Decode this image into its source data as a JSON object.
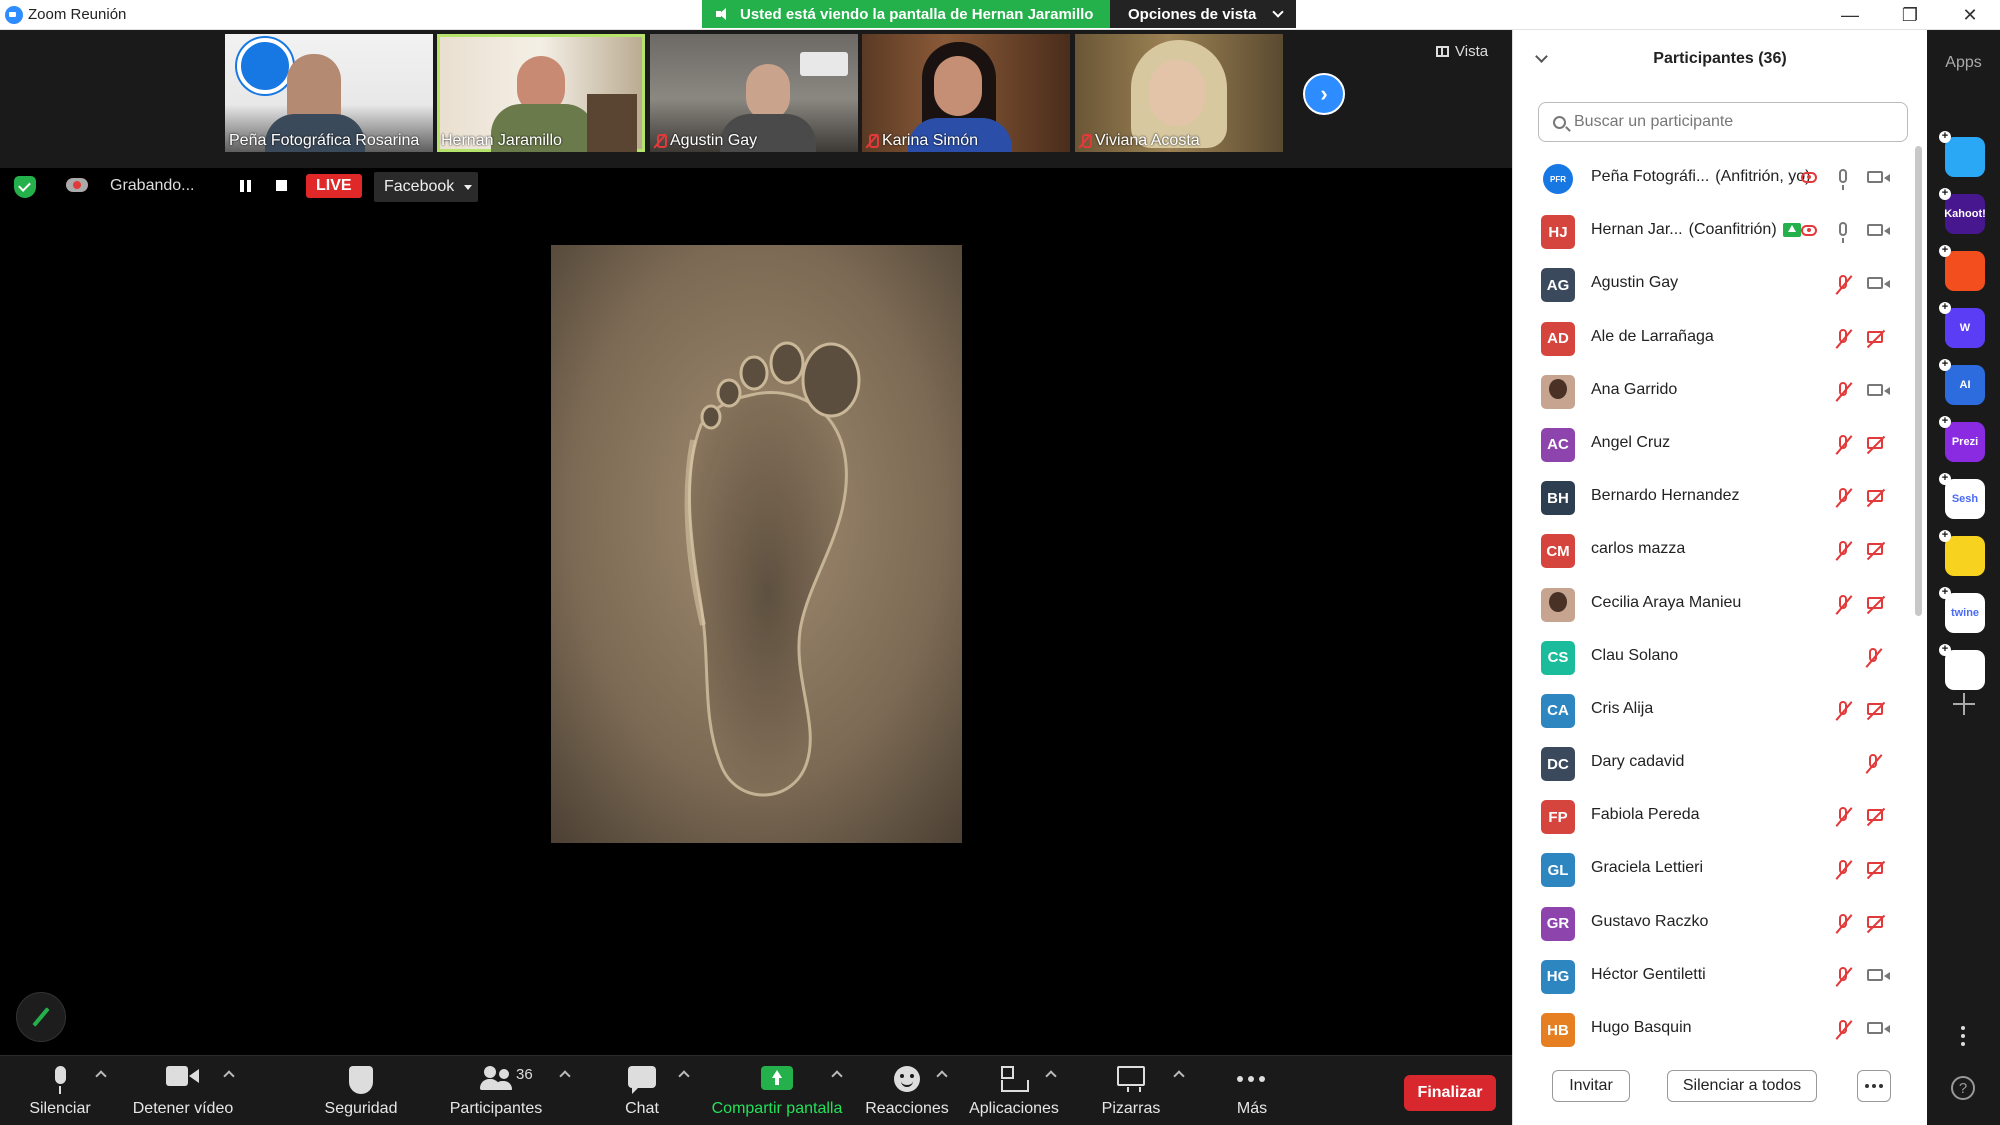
{
  "window": {
    "title": "Zoom Reunión",
    "controls": [
      "—",
      "❐",
      "✕"
    ]
  },
  "share_banner": {
    "message": "Usted está viendo la pantalla de Hernan Jaramillo",
    "view_options": "Opciones de vista"
  },
  "thumbnails": [
    {
      "name": "Peña Fotográfica Rosarina",
      "muted": false,
      "active": false
    },
    {
      "name": "Hernan Jaramillo",
      "muted": false,
      "active": true
    },
    {
      "name": "Agustin Gay",
      "muted": true,
      "active": false
    },
    {
      "name": "Karina Simón",
      "muted": true,
      "active": false
    },
    {
      "name": "Viviana Acosta",
      "muted": true,
      "active": false
    }
  ],
  "view_button": "Vista",
  "recording": {
    "status": "Grabando...",
    "live_badge": "LIVE",
    "platform": "Facebook"
  },
  "toolbar": {
    "mute": "Silenciar",
    "stop_video": "Detener vídeo",
    "security": "Seguridad",
    "participants": "Participantes",
    "participants_count": "36",
    "chat": "Chat",
    "share_screen": "Compartir pantalla",
    "reactions": "Reacciones",
    "apps": "Aplicaciones",
    "whiteboards": "Pizarras",
    "more": "Más",
    "end": "Finalizar"
  },
  "panel": {
    "title": "Participantes (36)",
    "search_placeholder": "Buscar un participante",
    "participants": [
      {
        "initials": "",
        "avatar": "logo",
        "name": "Peña Fotográfi...",
        "role": "(Anfitrión, yo)",
        "mic": "on",
        "cam": "on",
        "rec": true,
        "cohost": false,
        "color": "#ffffff"
      },
      {
        "initials": "HJ",
        "avatar": "initials",
        "name": "Hernan Jar...",
        "role": "(Coanfitrión)",
        "mic": "on",
        "cam": "on",
        "rec": true,
        "cohost": true,
        "color": "#d6453d"
      },
      {
        "initials": "AG",
        "avatar": "initials",
        "name": "Agustin Gay",
        "role": "",
        "mic": "off",
        "cam": "on",
        "rec": false,
        "cohost": false,
        "color": "#3a4a5c"
      },
      {
        "initials": "AD",
        "avatar": "initials",
        "name": "Ale de Larrañaga",
        "role": "",
        "mic": "off",
        "cam": "off",
        "rec": false,
        "cohost": false,
        "color": "#d6453d"
      },
      {
        "initials": "",
        "avatar": "photo",
        "name": "Ana Garrido",
        "role": "",
        "mic": "off",
        "cam": "on",
        "rec": false,
        "cohost": false,
        "color": "#c7a48f"
      },
      {
        "initials": "AC",
        "avatar": "initials",
        "name": "Angel Cruz",
        "role": "",
        "mic": "off",
        "cam": "off",
        "rec": false,
        "cohost": false,
        "color": "#8e44ad"
      },
      {
        "initials": "BH",
        "avatar": "initials",
        "name": "Bernardo Hernandez",
        "role": "",
        "mic": "off",
        "cam": "off",
        "rec": false,
        "cohost": false,
        "color": "#2c3e50"
      },
      {
        "initials": "CM",
        "avatar": "initials",
        "name": "carlos mazza",
        "role": "",
        "mic": "off",
        "cam": "off",
        "rec": false,
        "cohost": false,
        "color": "#d6453d"
      },
      {
        "initials": "",
        "avatar": "photo",
        "name": "Cecilia Araya Manieu",
        "role": "",
        "mic": "off",
        "cam": "off",
        "rec": false,
        "cohost": false,
        "color": "#c7a48f"
      },
      {
        "initials": "CS",
        "avatar": "initials",
        "name": "Clau Solano",
        "role": "",
        "mic": "off-far",
        "cam": "none",
        "rec": false,
        "cohost": false,
        "color": "#1abc9c"
      },
      {
        "initials": "CA",
        "avatar": "initials",
        "name": "Cris Alija",
        "role": "",
        "mic": "off",
        "cam": "off",
        "rec": false,
        "cohost": false,
        "color": "#2e86c1"
      },
      {
        "initials": "DC",
        "avatar": "initials",
        "name": "Dary cadavid",
        "role": "",
        "mic": "off-far",
        "cam": "none",
        "rec": false,
        "cohost": false,
        "color": "#3a4a5c"
      },
      {
        "initials": "FP",
        "avatar": "initials",
        "name": "Fabiola Pereda",
        "role": "",
        "mic": "off",
        "cam": "off",
        "rec": false,
        "cohost": false,
        "color": "#d6453d"
      },
      {
        "initials": "GL",
        "avatar": "initials",
        "name": "Graciela Lettieri",
        "role": "",
        "mic": "off",
        "cam": "off",
        "rec": false,
        "cohost": false,
        "color": "#2e86c1"
      },
      {
        "initials": "GR",
        "avatar": "initials",
        "name": "Gustavo Raczko",
        "role": "",
        "mic": "off",
        "cam": "off",
        "rec": false,
        "cohost": false,
        "color": "#8e44ad"
      },
      {
        "initials": "HG",
        "avatar": "initials",
        "name": "Héctor Gentiletti",
        "role": "",
        "mic": "off",
        "cam": "on",
        "rec": false,
        "cohost": false,
        "color": "#2e86c1"
      },
      {
        "initials": "HB",
        "avatar": "initials",
        "name": "Hugo Basquin",
        "role": "",
        "mic": "off",
        "cam": "on",
        "rec": false,
        "cohost": false,
        "color": "#e67e22"
      }
    ],
    "invite": "Invitar",
    "mute_all": "Silenciar a todos"
  },
  "apps_rail": {
    "label": "Apps",
    "apps": [
      {
        "name": "pitch-app-icon",
        "label": "",
        "color": "#2aa7f5"
      },
      {
        "name": "kahoot-app-icon",
        "label": "Kahoot!",
        "color": "#46178f"
      },
      {
        "name": "red-app-icon",
        "label": "",
        "color": "#f24e1e"
      },
      {
        "name": "wooclap-app-icon",
        "label": "W",
        "color": "#5a3df5"
      },
      {
        "name": "ai-app-icon",
        "label": "AI",
        "color": "#2d6cdf"
      },
      {
        "name": "prezi-app-icon",
        "label": "Prezi",
        "color": "#8a2be2"
      },
      {
        "name": "sesh-app-icon",
        "label": "Sesh",
        "color": "#ffffff"
      },
      {
        "name": "emoji-app-icon",
        "label": "",
        "color": "#f7d21e"
      },
      {
        "name": "twine-app-icon",
        "label": "twine",
        "color": "#ffffff"
      },
      {
        "name": "blocks-app-icon",
        "label": "",
        "color": "#ffffff"
      }
    ]
  }
}
